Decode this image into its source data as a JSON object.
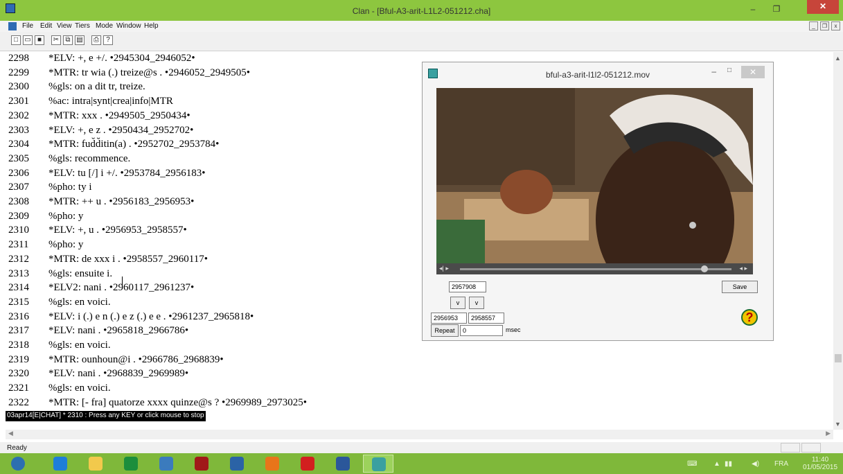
{
  "window": {
    "title": "Clan - [Bful-A3-arit-L1L2-051212.cha]",
    "minimize": "–",
    "maximize": "❐",
    "close": "✕"
  },
  "menu": [
    "File",
    "Edit",
    "View",
    "Tiers",
    "Mode",
    "Window",
    "Help"
  ],
  "mdi_controls": [
    "_",
    "❐",
    "x"
  ],
  "toolbar": [
    {
      "icon": "new-file-icon",
      "glyph": "□"
    },
    {
      "icon": "open-folder-icon",
      "glyph": "▭"
    },
    {
      "icon": "save-icon",
      "glyph": "■"
    },
    {
      "icon": "cut-icon",
      "glyph": "✂"
    },
    {
      "icon": "copy-icon",
      "glyph": "⧉"
    },
    {
      "icon": "paste-icon",
      "glyph": "▤"
    },
    {
      "icon": "print-icon",
      "glyph": "⎙"
    },
    {
      "icon": "help-icon",
      "glyph": "?"
    }
  ],
  "transcript": [
    {
      "num": "2298",
      "text": "*ELV:  +, e +/. •2945304_2946052•"
    },
    {
      "num": "2299",
      "text": "*MTR:  tr wia (.) treize@s . •2946052_2949505•"
    },
    {
      "num": "2300",
      "text": "%gls:  on a dit tr, treize."
    },
    {
      "num": "2301",
      "text": "%ac:  intra|synt|crea|info|MTR"
    },
    {
      "num": "2302",
      "text": "*MTR:  xxx . •2949505_2950434•"
    },
    {
      "num": "2303",
      "text": "*ELV:  +, e z . •2950434_2952702•"
    },
    {
      "num": "2304",
      "text": "*MTR:  fud̆d̆itin(a) . •2952702_2953784•"
    },
    {
      "num": "2305",
      "text": "%gls:  recommence."
    },
    {
      "num": "2306",
      "text": "*ELV:  tu [/] i +/. •2953784_2956183•"
    },
    {
      "num": "2307",
      "text": "%pho:  ty i"
    },
    {
      "num": "2308",
      "text": "*MTR:  ++ u . •2956183_2956953•"
    },
    {
      "num": "2309",
      "text": "%pho:  y"
    },
    {
      "num": "2310",
      "text": "*ELV:  +, u . •2956953_2958557•"
    },
    {
      "num": "2311",
      "text": "%pho:  y"
    },
    {
      "num": "2312",
      "text": "*MTR:  de xxx i . •2958557_2960117•"
    },
    {
      "num": "2313",
      "text": "%gls:  ensuite i."
    },
    {
      "num": "2314",
      "text": "*ELV2:  nani . •2960117_2961237•"
    },
    {
      "num": "2315",
      "text": "%gls:  en voici."
    },
    {
      "num": "2316",
      "text": "*ELV:  i (.) e n (.) e z (.) e e . •2961237_2965818•"
    },
    {
      "num": "2317",
      "text": "*ELV:  nani . •2965818_2966786•"
    },
    {
      "num": "2318",
      "text": "%gls:  en voici."
    },
    {
      "num": "2319",
      "text": "*MTR:  ounhoun@i . •2966786_2968839•"
    },
    {
      "num": "2320",
      "text": "*ELV:  nani . •2968839_2969989•"
    },
    {
      "num": "2321",
      "text": "%gls:  en voici."
    },
    {
      "num": "2322",
      "text": "*MTR:  [- fra] quatorze xxxx quinze@s ? •2969989_2973025•"
    }
  ],
  "status_message": "03apr14[E|CHAT] * 2310 : Press any KEY or click mouse to stop",
  "statusbar": {
    "ready": "Ready"
  },
  "media": {
    "title": "bful-a3-arit-l1l2-051212.mov",
    "minimize": "–",
    "maximize": "□",
    "close": "✕",
    "current_time": "2957908",
    "save_label": "Save",
    "v1": "v",
    "v2": "v",
    "start": "2956953",
    "end": "2958557",
    "repeat_label": "Repeat",
    "repeat_value": "0",
    "msec": "msec",
    "help": "?",
    "progress_fraction": 0.9
  },
  "taskbar": {
    "apps": [
      {
        "name": "start-icon",
        "color": "#2c6fb0"
      },
      {
        "name": "internet-explorer-icon",
        "color": "#1e7ed8"
      },
      {
        "name": "file-explorer-icon",
        "color": "#f2c94c"
      },
      {
        "name": "store-icon",
        "color": "#1c8e3c"
      },
      {
        "name": "remote-desktop-icon",
        "color": "#3b7bbd"
      },
      {
        "name": "media-icon",
        "color": "#a01919"
      },
      {
        "name": "control-panel-icon",
        "color": "#2b63a6"
      },
      {
        "name": "firefox-icon",
        "color": "#e8751a"
      },
      {
        "name": "opera-icon",
        "color": "#d21f1f"
      },
      {
        "name": "word-icon",
        "color": "#2b579a"
      },
      {
        "name": "clan-icon",
        "color": "#3aa0a0"
      }
    ],
    "lang": "FRA",
    "time": "11:40",
    "date": "01/05/2015"
  }
}
